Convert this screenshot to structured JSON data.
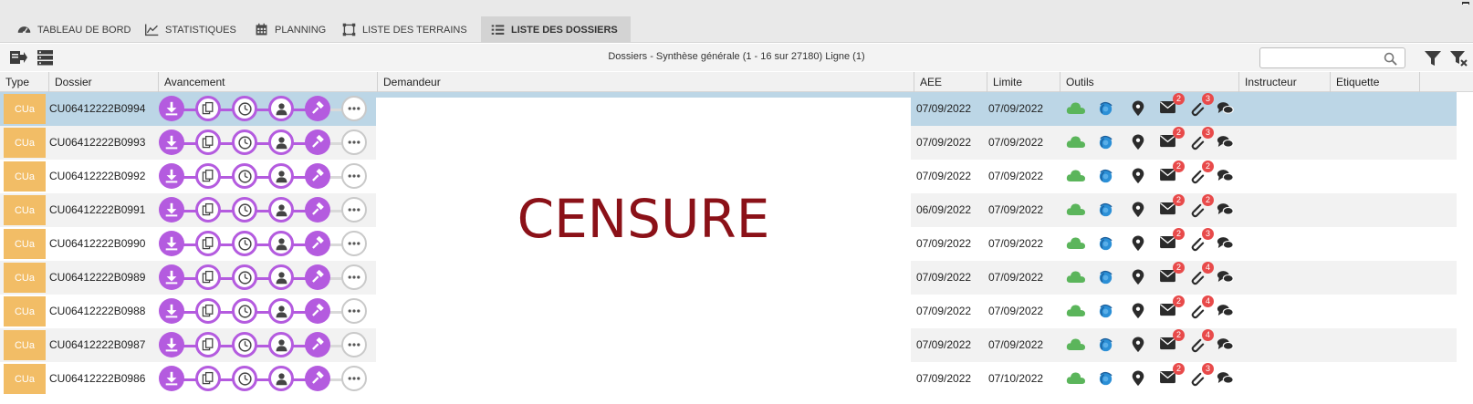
{
  "tabs": [
    {
      "label": "TABLEAU DE BORD",
      "icon": "dashboard-icon",
      "active": false
    },
    {
      "label": "STATISTIQUES",
      "icon": "chart-line-icon",
      "active": false
    },
    {
      "label": "PLANNING",
      "icon": "calendar-icon",
      "active": false
    },
    {
      "label": "LISTE DES TERRAINS",
      "icon": "parcel-shape-icon",
      "active": false
    },
    {
      "label": "LISTE DES DOSSIERS",
      "icon": "list-icon",
      "active": true
    }
  ],
  "toolbar": {
    "summary": "Dossiers - Synthèse générale (1 - 16 sur 27180) Ligne (1)",
    "search_value": "",
    "search_placeholder": ""
  },
  "columns": {
    "type": "Type",
    "dossier": "Dossier",
    "avancement": "Avancement",
    "demandeur": "Demandeur",
    "aee": "AEE",
    "limite": "Limite",
    "outils": "Outils",
    "instructeur": "Instructeur",
    "etiquette": "Etiquette"
  },
  "progress_steps": [
    "download-icon",
    "copy-icon",
    "clock-icon",
    "person-icon",
    "gavel-icon",
    "more-icon"
  ],
  "censor_text": "CENSURE",
  "colors": {
    "type_badge": "#f2bd66",
    "progress": "#b45bdf",
    "selected_row": "#bcd6e6",
    "cloud": "#5bb55b",
    "globe": "#2b8fd6",
    "badge": "#e84a4a",
    "censor": "#8b1118"
  },
  "rows": [
    {
      "type": "CUa",
      "dossier": "CU06412222B0994",
      "aee": "07/09/2022",
      "limite": "07/09/2022",
      "mail_count": "2",
      "attach_count": "3",
      "selected": true
    },
    {
      "type": "CUa",
      "dossier": "CU06412222B0993",
      "aee": "07/09/2022",
      "limite": "07/09/2022",
      "mail_count": "2",
      "attach_count": "3",
      "selected": false
    },
    {
      "type": "CUa",
      "dossier": "CU06412222B0992",
      "aee": "07/09/2022",
      "limite": "07/09/2022",
      "mail_count": "2",
      "attach_count": "2",
      "selected": false
    },
    {
      "type": "CUa",
      "dossier": "CU06412222B0991",
      "aee": "06/09/2022",
      "limite": "07/09/2022",
      "mail_count": "2",
      "attach_count": "2",
      "selected": false
    },
    {
      "type": "CUa",
      "dossier": "CU06412222B0990",
      "aee": "07/09/2022",
      "limite": "07/09/2022",
      "mail_count": "2",
      "attach_count": "3",
      "selected": false
    },
    {
      "type": "CUa",
      "dossier": "CU06412222B0989",
      "aee": "07/09/2022",
      "limite": "07/09/2022",
      "mail_count": "2",
      "attach_count": "4",
      "selected": false
    },
    {
      "type": "CUa",
      "dossier": "CU06412222B0988",
      "aee": "07/09/2022",
      "limite": "07/09/2022",
      "mail_count": "2",
      "attach_count": "4",
      "selected": false
    },
    {
      "type": "CUa",
      "dossier": "CU06412222B0987",
      "aee": "07/09/2022",
      "limite": "07/09/2022",
      "mail_count": "2",
      "attach_count": "4",
      "selected": false
    },
    {
      "type": "CUa",
      "dossier": "CU06412222B0986",
      "aee": "07/09/2022",
      "limite": "07/10/2022",
      "mail_count": "2",
      "attach_count": "3",
      "selected": false
    }
  ]
}
